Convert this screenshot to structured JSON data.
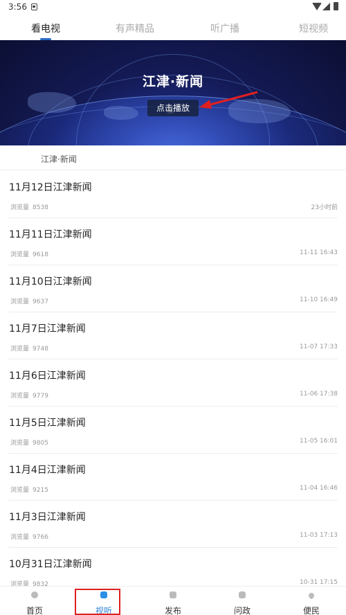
{
  "status_bar": {
    "time": "3:56"
  },
  "tabs": [
    {
      "label": "看电视",
      "active": true
    },
    {
      "label": "有声精品",
      "active": false
    },
    {
      "label": "听广播",
      "active": false
    },
    {
      "label": "短视频",
      "active": false
    }
  ],
  "banner": {
    "title": "江津·新闻",
    "play_label": "点击播放"
  },
  "section_label": "江津·新闻",
  "list": {
    "views_label": "浏览量",
    "items": [
      {
        "title": "11月12日江津新闻",
        "views": "8538",
        "date": "23小时前"
      },
      {
        "title": "11月11日江津新闻",
        "views": "9618",
        "date": "11-11 16:43"
      },
      {
        "title": "11月10日江津新闻",
        "views": "9637",
        "date": "11-10 16:49"
      },
      {
        "title": "11月7日江津新闻",
        "views": "9748",
        "date": "11-07 17:33"
      },
      {
        "title": "11月6日江津新闻",
        "views": "9779",
        "date": "11-06 17:38"
      },
      {
        "title": "11月5日江津新闻",
        "views": "9805",
        "date": "11-05 16:01"
      },
      {
        "title": "11月4日江津新闻",
        "views": "9215",
        "date": "11-04 16:46"
      },
      {
        "title": "11月3日江津新闻",
        "views": "9766",
        "date": "11-03 17:13"
      },
      {
        "title": "10月31日江津新闻",
        "views": "9832",
        "date": "10-31 17:15"
      }
    ]
  },
  "bottom_nav": [
    {
      "label": "首页",
      "icon": "home-icon",
      "active": false
    },
    {
      "label": "视听",
      "icon": "tv-icon",
      "active": true
    },
    {
      "label": "发布",
      "icon": "publish-icon",
      "active": false
    },
    {
      "label": "问政",
      "icon": "politics-icon",
      "active": false
    },
    {
      "label": "便民",
      "icon": "heart-icon",
      "active": false
    }
  ],
  "colors": {
    "accent": "#2b7fd6",
    "annotation": "#e01f1f"
  }
}
